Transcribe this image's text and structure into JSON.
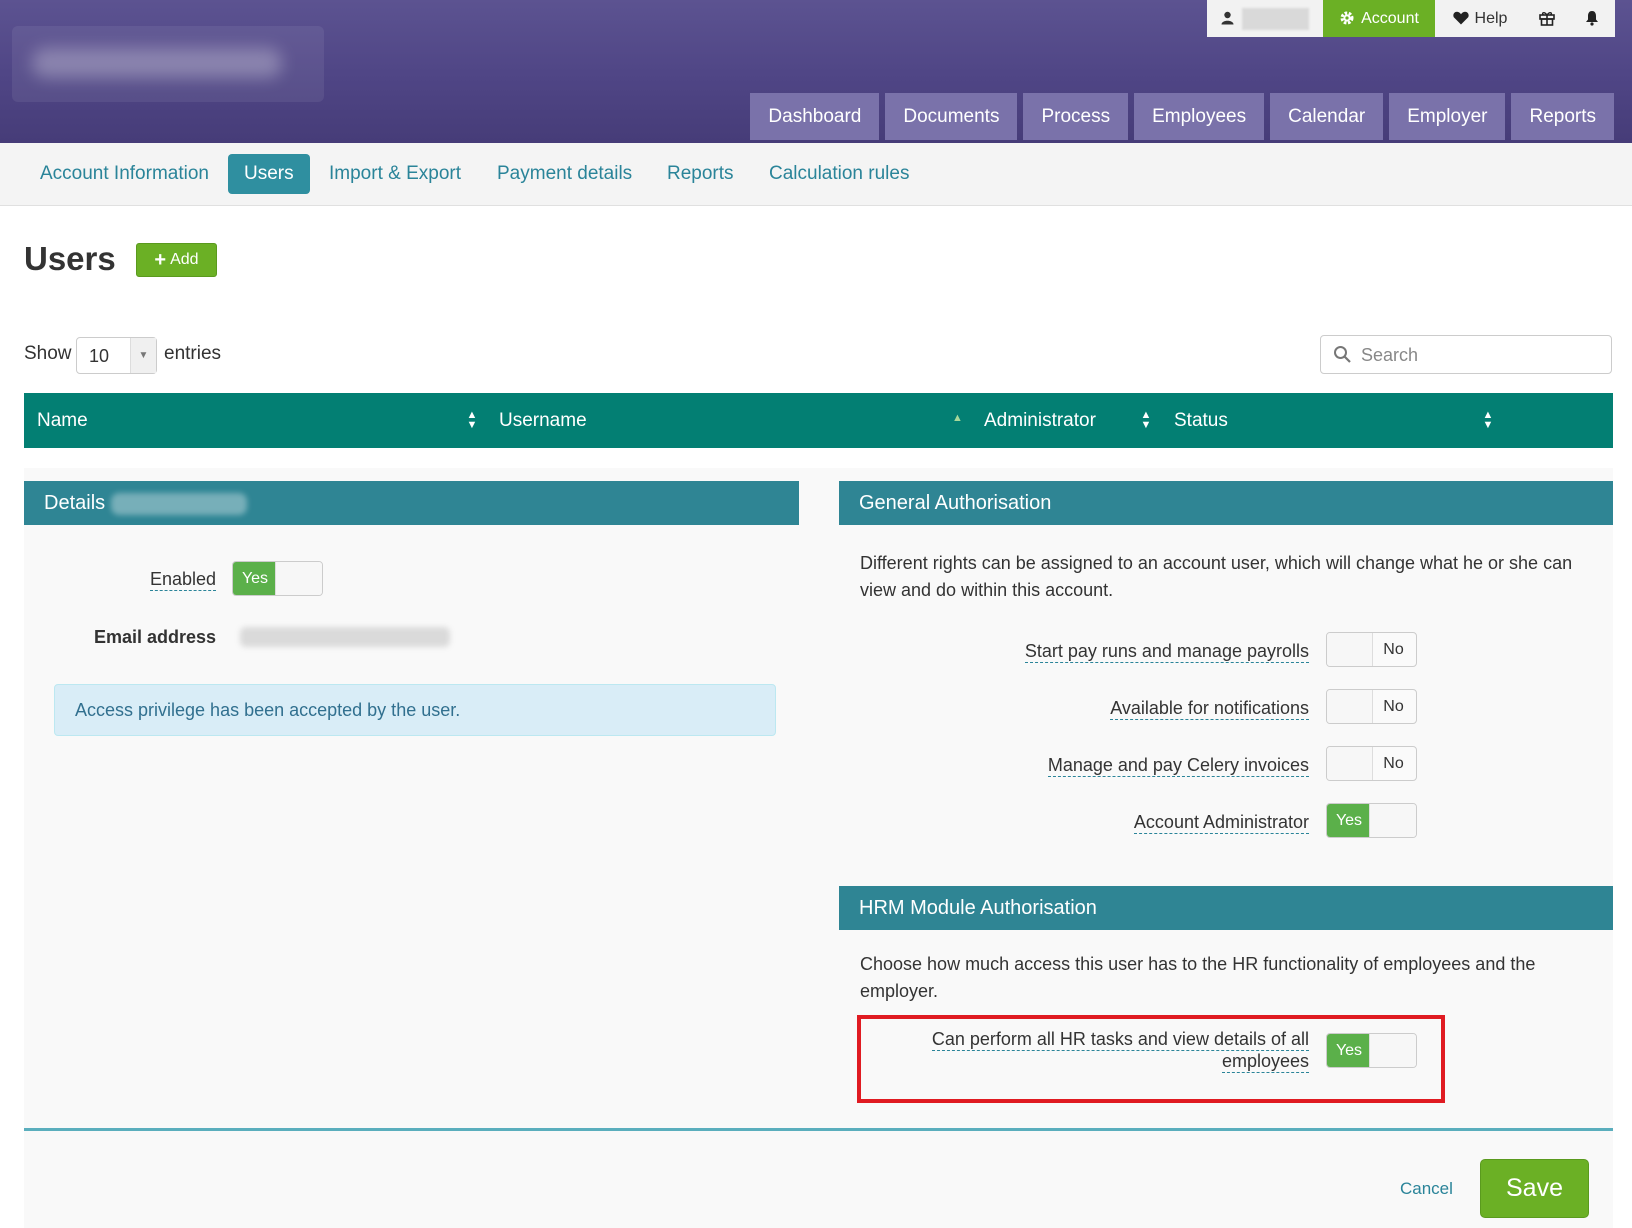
{
  "topbar": {
    "account_label": "Account",
    "help_label": "Help"
  },
  "main_nav": [
    "Dashboard",
    "Documents",
    "Process",
    "Employees",
    "Calendar",
    "Employer",
    "Reports"
  ],
  "sub_nav": {
    "tabs": [
      "Account Information",
      "Users",
      "Import & Export",
      "Payment details",
      "Reports",
      "Calculation rules"
    ],
    "active": "Users"
  },
  "page": {
    "title": "Users",
    "add_label": "Add"
  },
  "table_controls": {
    "show_label": "Show",
    "page_size": "10",
    "entries_label": "entries",
    "search_placeholder": "Search"
  },
  "table": {
    "columns": [
      "Name",
      "Username",
      "Administrator",
      "Status"
    ]
  },
  "details": {
    "header": "Details",
    "enabled_label": "Enabled",
    "enabled_value": "Yes",
    "email_label": "Email address",
    "info_message": "Access privilege has been accepted by the user."
  },
  "general_auth": {
    "header": "General Authorisation",
    "description": "Different rights can be assigned to an account user, which will change what he or she can view and do within this account.",
    "rights": [
      {
        "label": "Start pay runs and manage payrolls",
        "value": "No"
      },
      {
        "label": "Available for notifications",
        "value": "No"
      },
      {
        "label": "Manage and pay Celery invoices",
        "value": "No"
      },
      {
        "label": "Account Administrator",
        "value": "Yes"
      }
    ]
  },
  "hrm_auth": {
    "header": "HRM Module Authorisation",
    "description": "Choose how much access this user has to the HR functionality of employees and the employer.",
    "rights": [
      {
        "label_line1": "Can perform all HR tasks and view details of all",
        "label_line2": "employees",
        "value": "Yes"
      }
    ]
  },
  "footer": {
    "cancel_label": "Cancel",
    "save_label": "Save"
  },
  "colors": {
    "header_purple": "#4f4585",
    "accent_green": "#6bb025",
    "table_teal": "#037f73",
    "panel_teal": "#2f8594",
    "highlight_red": "#e01b22"
  }
}
